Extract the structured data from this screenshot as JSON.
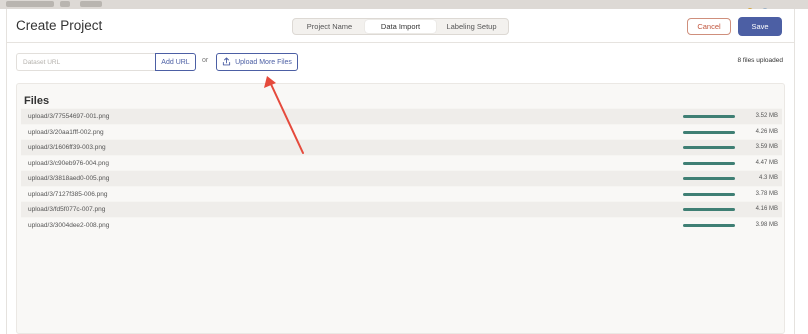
{
  "colors": {
    "accent": "#4c5fa4",
    "cancel": "#c0553d",
    "progress": "#3f7f74",
    "arrow": "#e54a3c"
  },
  "header": {
    "title": "Create Project",
    "tabs": [
      {
        "label": "Project Name",
        "active": false
      },
      {
        "label": "Data Import",
        "active": true
      },
      {
        "label": "Labeling Setup",
        "active": false
      }
    ],
    "cancel_label": "Cancel",
    "save_label": "Save"
  },
  "import": {
    "url_placeholder": "Dataset URL",
    "add_url_label": "Add URL",
    "or_label": "or",
    "upload_label": "Upload More Files",
    "upload_icon": "upload-icon",
    "files_count": "8 files uploaded"
  },
  "files": {
    "heading": "Files",
    "items": [
      {
        "name": "upload/3/77554697-001.png",
        "size": "3.52 MB",
        "progress": 1.0
      },
      {
        "name": "upload/3/20aa1fff-002.png",
        "size": "4.26 MB",
        "progress": 1.0
      },
      {
        "name": "upload/3/1606ff39-003.png",
        "size": "3.59 MB",
        "progress": 1.0
      },
      {
        "name": "upload/3/c90eb976-004.png",
        "size": "4.47 MB",
        "progress": 1.0
      },
      {
        "name": "upload/3/3818aed0-005.png",
        "size": "4.3 MB",
        "progress": 1.0
      },
      {
        "name": "upload/3/7127f385-006.png",
        "size": "3.78 MB",
        "progress": 1.0
      },
      {
        "name": "upload/3/fd5f077c-007.png",
        "size": "4.16 MB",
        "progress": 1.0
      },
      {
        "name": "upload/3/3004dee2-008.png",
        "size": "3.98 MB",
        "progress": 1.0
      }
    ]
  }
}
